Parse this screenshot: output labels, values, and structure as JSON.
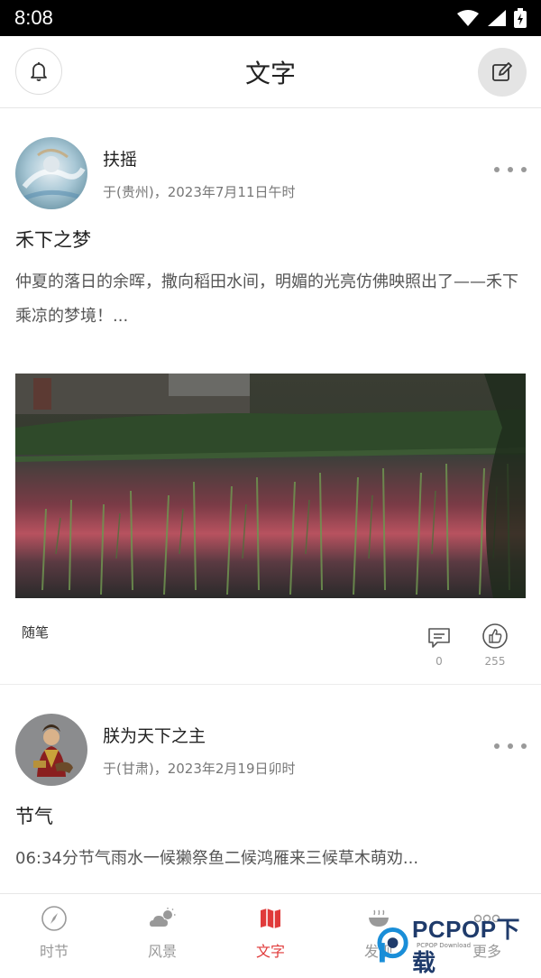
{
  "status_bar": {
    "time": "8:08"
  },
  "header": {
    "title": "文字"
  },
  "posts": [
    {
      "author": "扶摇",
      "meta": "于(贵州)，2023年7月11日午时",
      "title": "禾下之梦",
      "excerpt": "仲夏的落日的余晖，撒向稻田水间，明媚的光亮仿佛映照出了——禾下乘凉的梦境！...",
      "tag": "随笔",
      "comments": "0",
      "likes": "255"
    },
    {
      "author": "朕为天下之主",
      "meta": "于(甘肃)，2023年2月19日卯时",
      "title": "节气",
      "excerpt": "06:34分节气雨水一候獭祭鱼二候鸿雁来三候草木萌劝..."
    }
  ],
  "bottom_nav": [
    {
      "label": "时节",
      "icon": "compass-icon"
    },
    {
      "label": "风景",
      "icon": "weather-icon"
    },
    {
      "label": "文字",
      "icon": "map-icon",
      "active": true
    },
    {
      "label": "发现",
      "icon": "bowl-icon"
    },
    {
      "label": "更多",
      "icon": "more-dots-icon"
    }
  ],
  "watermark": {
    "brand": "PCPOP下载",
    "sub": "PCPOP Download"
  },
  "colors": {
    "accent": "#e03a3a",
    "text": "#222222",
    "muted": "#999999"
  }
}
